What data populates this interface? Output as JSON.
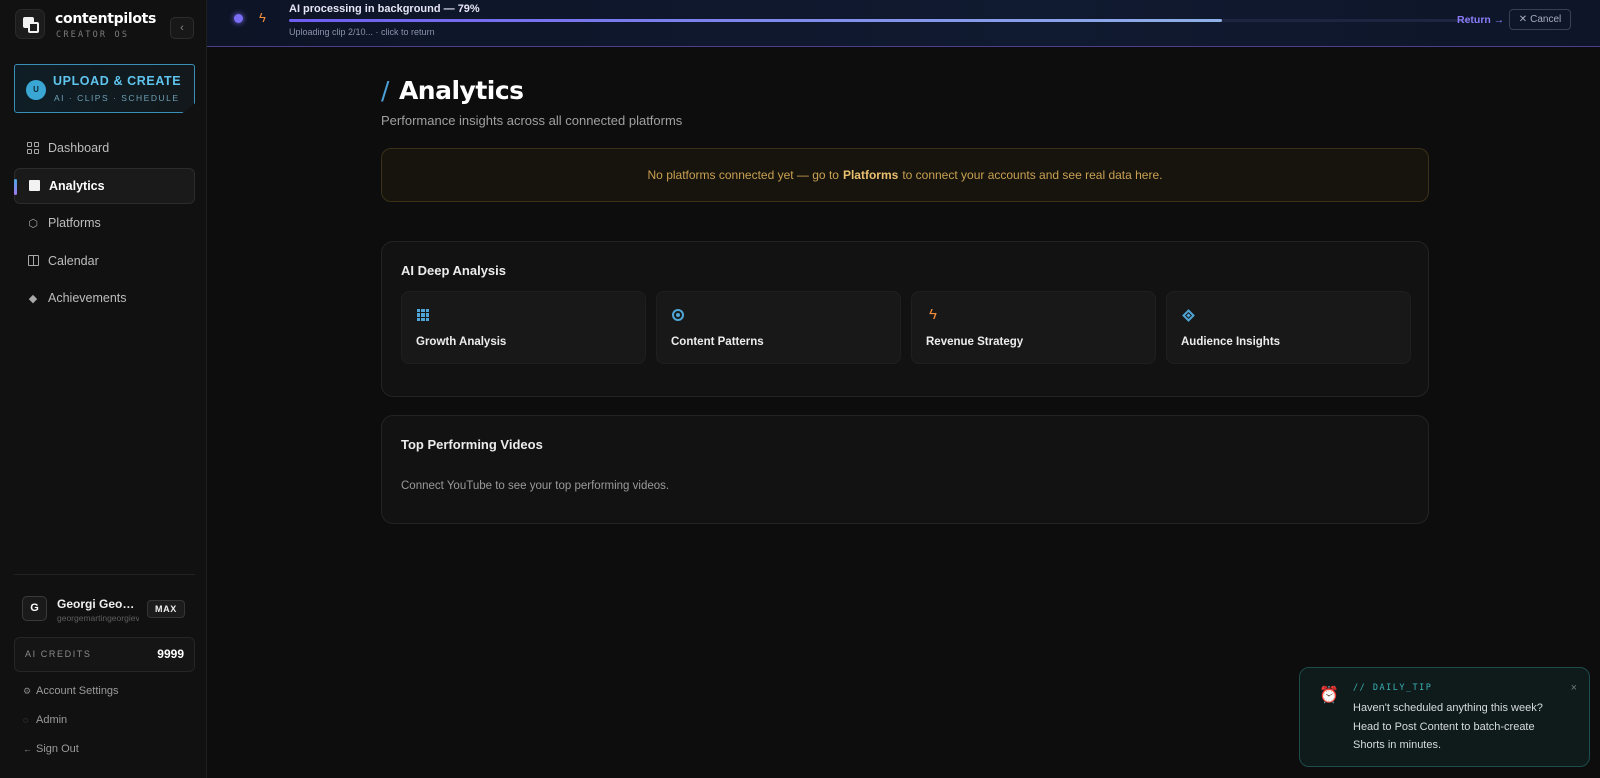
{
  "brand": {
    "name": "contentpilots",
    "subtitle": "CREATOR OS"
  },
  "upload": {
    "avatar": "U",
    "title": "UPLOAD & CREATE",
    "subtitle": "AI · CLIPS · SCHEDULE"
  },
  "nav": [
    {
      "label": "Dashboard",
      "icon": "dashboard-grid-icon",
      "active": false
    },
    {
      "label": "Analytics",
      "icon": "analytics-square-icon",
      "active": true
    },
    {
      "label": "Platforms",
      "icon": "hexagon-icon",
      "active": false
    },
    {
      "label": "Calendar",
      "icon": "calendar-icon",
      "active": false
    },
    {
      "label": "Achievements",
      "icon": "diamond-icon",
      "active": false
    }
  ],
  "user": {
    "initial": "G",
    "name": "Georgi Georgiev",
    "email": "georgemartingeorgiev",
    "plan": "MAX"
  },
  "credits": {
    "label": "AI CREDITS",
    "value": "9999"
  },
  "footer_links": {
    "settings": "Account Settings",
    "admin": "Admin",
    "signout": "Sign Out"
  },
  "processing": {
    "title": "AI processing in background — 79%",
    "progress_percent": 79,
    "subtitle": "Uploading clip 2/10... · click to return",
    "return_label": "Return →",
    "cancel_label": "Cancel"
  },
  "page": {
    "title": "Analytics",
    "subtitle": "Performance insights across all connected platforms"
  },
  "notice": {
    "before": "No platforms connected yet — go to",
    "link": "Platforms",
    "after": "to connect your accounts and see real data here."
  },
  "ai_analysis": {
    "title": "AI Deep Analysis",
    "tiles": [
      {
        "label": "Growth Analysis",
        "icon": "grid-chart-icon"
      },
      {
        "label": "Content Patterns",
        "icon": "target-icon"
      },
      {
        "label": "Revenue Strategy",
        "icon": "bolt-icon"
      },
      {
        "label": "Audience Insights",
        "icon": "diamond-icon"
      }
    ]
  },
  "top_videos": {
    "title": "Top Performing Videos",
    "message": "Connect YouTube to see your top performing videos."
  },
  "toast": {
    "tag": "// DAILY_TIP",
    "body": "Haven't scheduled anything this week? Head to Post Content to batch-create Shorts in minutes.",
    "close": "×"
  },
  "colors": {
    "accent_blue": "#4fa6d6",
    "accent_purple": "#7b6df5",
    "accent_orange": "#f28c3b",
    "notice_text": "#c8a052",
    "toast_accent": "#3ab1b5"
  }
}
